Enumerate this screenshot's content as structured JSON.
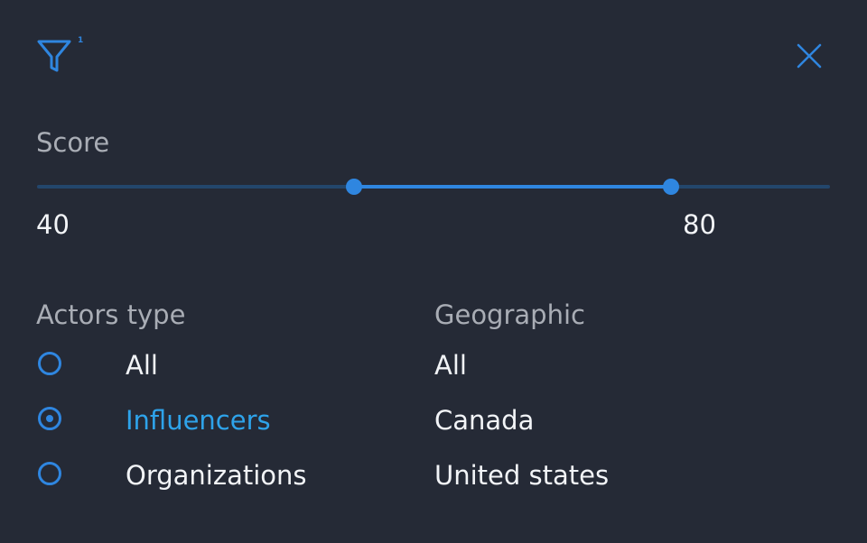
{
  "header": {
    "filter_icon": "funnel-icon",
    "filter_count": "1",
    "close_icon": "close-icon"
  },
  "score": {
    "label": "Score",
    "range_min": 0,
    "range_max": 100,
    "min_value": "40",
    "max_value": "80"
  },
  "actors": {
    "title": "Actors type",
    "options": [
      {
        "label": "All",
        "selected": false
      },
      {
        "label": "Influencers",
        "selected": true
      },
      {
        "label": "Organizations",
        "selected": false
      }
    ]
  },
  "geographic": {
    "title": "Geographic",
    "options": [
      "All",
      "Canada",
      "United states"
    ]
  },
  "colors": {
    "background": "#252a36",
    "accent": "#2f86e0",
    "selected_text": "#2ea3ea",
    "muted_text": "#a9adb5",
    "text": "#f2f4f7",
    "track": "#23466c"
  }
}
